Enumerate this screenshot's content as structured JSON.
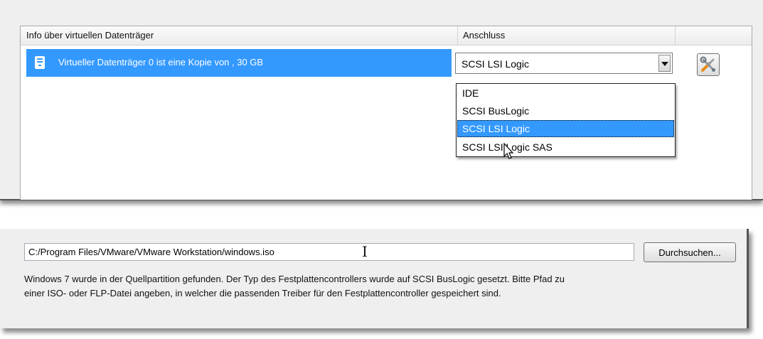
{
  "disk_table": {
    "headers": {
      "info": "Info über virtuellen Datenträger",
      "connection": "Anschluss"
    },
    "rows": [
      {
        "label": "Virtueller Datenträger 0 ist eine Kopie von , 30 GB",
        "connection": "SCSI LSI Logic",
        "icon": "virtual-disk-icon"
      }
    ],
    "settings_icon": "wrench-screwdriver-icon",
    "dropdown_options": [
      "IDE",
      "SCSI BusLogic",
      "SCSI LSI Logic",
      "SCSI LSI Logic SAS"
    ],
    "dropdown_selected": "SCSI LSI Logic"
  },
  "driver": {
    "path_value": "C:/Program Files/VMware/VMware Workstation/windows.iso",
    "browse_label": "Durchsuchen...",
    "info_line1": "Windows 7 wurde in der Quellpartition gefunden. Der Typ des Festplattencontrollers wurde auf SCSI BusLogic gesetzt. Bitte Pfad zu",
    "info_line2": "einer ISO- oder FLP-Datei angeben, in welcher die passenden Treiber für den Festplattencontroller gespeichert sind."
  },
  "colors": {
    "selection": "#3399ff",
    "panel_bg": "#efefef"
  }
}
